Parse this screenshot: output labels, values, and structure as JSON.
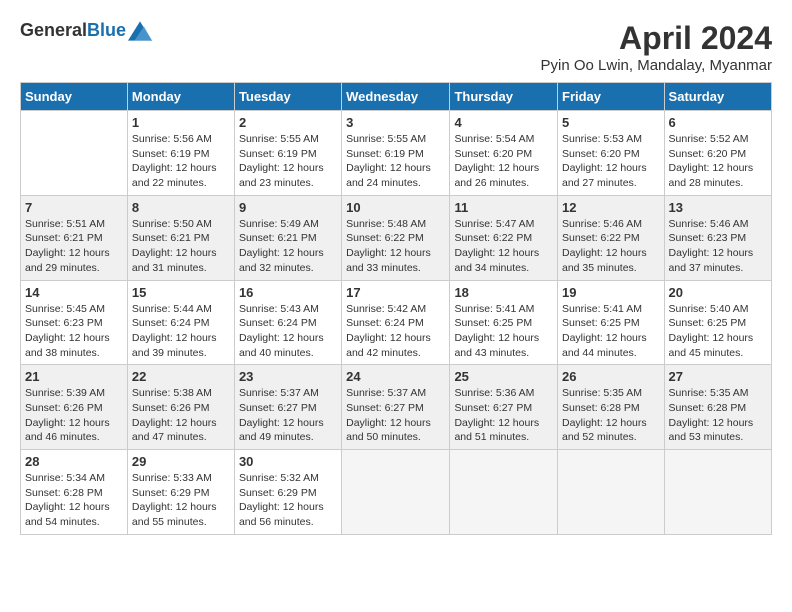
{
  "header": {
    "logo_general": "General",
    "logo_blue": "Blue",
    "month_title": "April 2024",
    "location": "Pyin Oo Lwin, Mandalay, Myanmar"
  },
  "days_of_week": [
    "Sunday",
    "Monday",
    "Tuesday",
    "Wednesday",
    "Thursday",
    "Friday",
    "Saturday"
  ],
  "weeks": [
    [
      {
        "day": "",
        "sunrise": "",
        "sunset": "",
        "daylight": ""
      },
      {
        "day": "1",
        "sunrise": "Sunrise: 5:56 AM",
        "sunset": "Sunset: 6:19 PM",
        "daylight": "Daylight: 12 hours and 22 minutes."
      },
      {
        "day": "2",
        "sunrise": "Sunrise: 5:55 AM",
        "sunset": "Sunset: 6:19 PM",
        "daylight": "Daylight: 12 hours and 23 minutes."
      },
      {
        "day": "3",
        "sunrise": "Sunrise: 5:55 AM",
        "sunset": "Sunset: 6:19 PM",
        "daylight": "Daylight: 12 hours and 24 minutes."
      },
      {
        "day": "4",
        "sunrise": "Sunrise: 5:54 AM",
        "sunset": "Sunset: 6:20 PM",
        "daylight": "Daylight: 12 hours and 26 minutes."
      },
      {
        "day": "5",
        "sunrise": "Sunrise: 5:53 AM",
        "sunset": "Sunset: 6:20 PM",
        "daylight": "Daylight: 12 hours and 27 minutes."
      },
      {
        "day": "6",
        "sunrise": "Sunrise: 5:52 AM",
        "sunset": "Sunset: 6:20 PM",
        "daylight": "Daylight: 12 hours and 28 minutes."
      }
    ],
    [
      {
        "day": "7",
        "sunrise": "Sunrise: 5:51 AM",
        "sunset": "Sunset: 6:21 PM",
        "daylight": "Daylight: 12 hours and 29 minutes."
      },
      {
        "day": "8",
        "sunrise": "Sunrise: 5:50 AM",
        "sunset": "Sunset: 6:21 PM",
        "daylight": "Daylight: 12 hours and 31 minutes."
      },
      {
        "day": "9",
        "sunrise": "Sunrise: 5:49 AM",
        "sunset": "Sunset: 6:21 PM",
        "daylight": "Daylight: 12 hours and 32 minutes."
      },
      {
        "day": "10",
        "sunrise": "Sunrise: 5:48 AM",
        "sunset": "Sunset: 6:22 PM",
        "daylight": "Daylight: 12 hours and 33 minutes."
      },
      {
        "day": "11",
        "sunrise": "Sunrise: 5:47 AM",
        "sunset": "Sunset: 6:22 PM",
        "daylight": "Daylight: 12 hours and 34 minutes."
      },
      {
        "day": "12",
        "sunrise": "Sunrise: 5:46 AM",
        "sunset": "Sunset: 6:22 PM",
        "daylight": "Daylight: 12 hours and 35 minutes."
      },
      {
        "day": "13",
        "sunrise": "Sunrise: 5:46 AM",
        "sunset": "Sunset: 6:23 PM",
        "daylight": "Daylight: 12 hours and 37 minutes."
      }
    ],
    [
      {
        "day": "14",
        "sunrise": "Sunrise: 5:45 AM",
        "sunset": "Sunset: 6:23 PM",
        "daylight": "Daylight: 12 hours and 38 minutes."
      },
      {
        "day": "15",
        "sunrise": "Sunrise: 5:44 AM",
        "sunset": "Sunset: 6:24 PM",
        "daylight": "Daylight: 12 hours and 39 minutes."
      },
      {
        "day": "16",
        "sunrise": "Sunrise: 5:43 AM",
        "sunset": "Sunset: 6:24 PM",
        "daylight": "Daylight: 12 hours and 40 minutes."
      },
      {
        "day": "17",
        "sunrise": "Sunrise: 5:42 AM",
        "sunset": "Sunset: 6:24 PM",
        "daylight": "Daylight: 12 hours and 42 minutes."
      },
      {
        "day": "18",
        "sunrise": "Sunrise: 5:41 AM",
        "sunset": "Sunset: 6:25 PM",
        "daylight": "Daylight: 12 hours and 43 minutes."
      },
      {
        "day": "19",
        "sunrise": "Sunrise: 5:41 AM",
        "sunset": "Sunset: 6:25 PM",
        "daylight": "Daylight: 12 hours and 44 minutes."
      },
      {
        "day": "20",
        "sunrise": "Sunrise: 5:40 AM",
        "sunset": "Sunset: 6:25 PM",
        "daylight": "Daylight: 12 hours and 45 minutes."
      }
    ],
    [
      {
        "day": "21",
        "sunrise": "Sunrise: 5:39 AM",
        "sunset": "Sunset: 6:26 PM",
        "daylight": "Daylight: 12 hours and 46 minutes."
      },
      {
        "day": "22",
        "sunrise": "Sunrise: 5:38 AM",
        "sunset": "Sunset: 6:26 PM",
        "daylight": "Daylight: 12 hours and 47 minutes."
      },
      {
        "day": "23",
        "sunrise": "Sunrise: 5:37 AM",
        "sunset": "Sunset: 6:27 PM",
        "daylight": "Daylight: 12 hours and 49 minutes."
      },
      {
        "day": "24",
        "sunrise": "Sunrise: 5:37 AM",
        "sunset": "Sunset: 6:27 PM",
        "daylight": "Daylight: 12 hours and 50 minutes."
      },
      {
        "day": "25",
        "sunrise": "Sunrise: 5:36 AM",
        "sunset": "Sunset: 6:27 PM",
        "daylight": "Daylight: 12 hours and 51 minutes."
      },
      {
        "day": "26",
        "sunrise": "Sunrise: 5:35 AM",
        "sunset": "Sunset: 6:28 PM",
        "daylight": "Daylight: 12 hours and 52 minutes."
      },
      {
        "day": "27",
        "sunrise": "Sunrise: 5:35 AM",
        "sunset": "Sunset: 6:28 PM",
        "daylight": "Daylight: 12 hours and 53 minutes."
      }
    ],
    [
      {
        "day": "28",
        "sunrise": "Sunrise: 5:34 AM",
        "sunset": "Sunset: 6:28 PM",
        "daylight": "Daylight: 12 hours and 54 minutes."
      },
      {
        "day": "29",
        "sunrise": "Sunrise: 5:33 AM",
        "sunset": "Sunset: 6:29 PM",
        "daylight": "Daylight: 12 hours and 55 minutes."
      },
      {
        "day": "30",
        "sunrise": "Sunrise: 5:32 AM",
        "sunset": "Sunset: 6:29 PM",
        "daylight": "Daylight: 12 hours and 56 minutes."
      },
      {
        "day": "",
        "sunrise": "",
        "sunset": "",
        "daylight": ""
      },
      {
        "day": "",
        "sunrise": "",
        "sunset": "",
        "daylight": ""
      },
      {
        "day": "",
        "sunrise": "",
        "sunset": "",
        "daylight": ""
      },
      {
        "day": "",
        "sunrise": "",
        "sunset": "",
        "daylight": ""
      }
    ]
  ]
}
